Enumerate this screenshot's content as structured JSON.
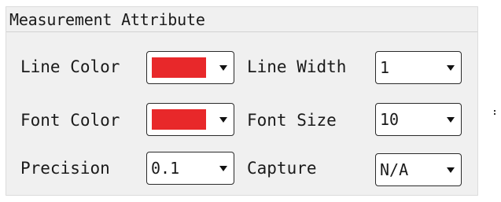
{
  "panel": {
    "title": "Measurement Attribute"
  },
  "line_color": {
    "label": "Line Color",
    "color": "#e8282a"
  },
  "line_width": {
    "label": "Line Width",
    "value": "1"
  },
  "font_color": {
    "label": "Font Color",
    "color": "#e8282a"
  },
  "font_size": {
    "label": "Font Size",
    "value": "10"
  },
  "precision": {
    "label": "Precision",
    "value": "0.1"
  },
  "capture": {
    "label": "Capture",
    "value": "N/A"
  },
  "icons": {
    "dropdown": "chevron-down-icon"
  }
}
